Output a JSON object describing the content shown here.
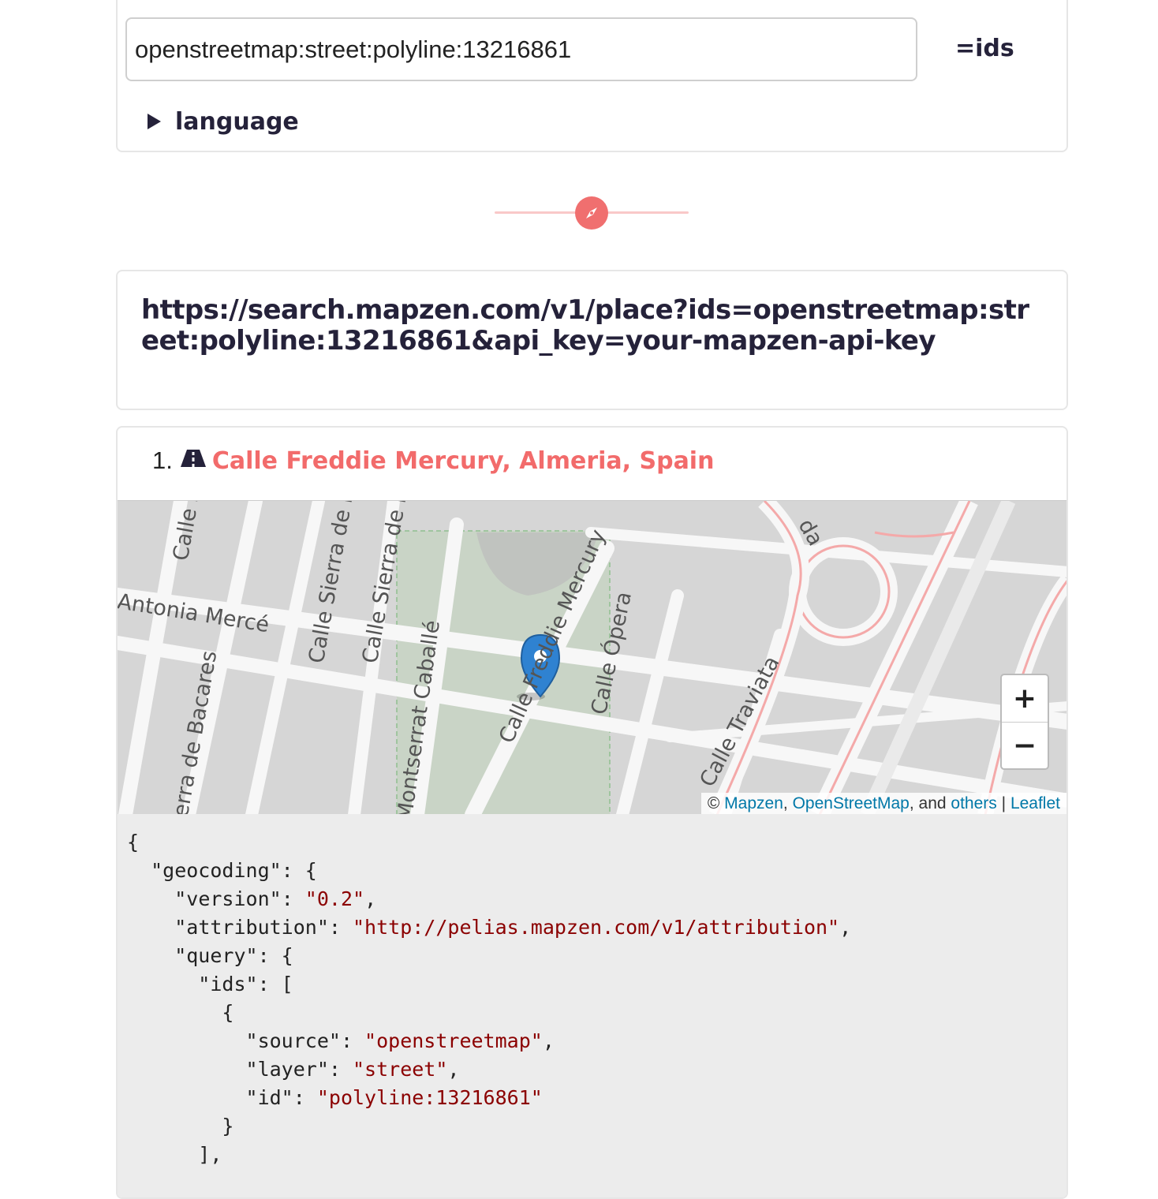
{
  "params": {
    "ids_value": "openstreetmap:street:polyline:13216861",
    "ids_label": "=ids",
    "language_label": "language"
  },
  "request": {
    "url": "https://search.mapzen.com/v1/place?ids=openstreetmap:street:polyline:13216861&api_key=your-mapzen-api-key"
  },
  "result": {
    "number": "1.",
    "name": "Calle Freddie Mercury, Almeria, Spain",
    "icon": "road-icon"
  },
  "map": {
    "streets": [
      "Calle S",
      "Antonia Mercé",
      "Calle Sierra de M",
      "Calle Sierra de M",
      "erra de Bacares",
      "Montserrat Caballé",
      "Calle Freddie Mercury",
      "Calle Ópera",
      "Calle Traviata",
      "da"
    ],
    "zoom_in": "+",
    "zoom_out": "−",
    "attribution": {
      "prefix": "©",
      "mapzen": "Mapzen",
      "sep1": ",",
      "osm": "OpenStreetMap",
      "sep2": ", and",
      "others": "others",
      "sep3": "|",
      "leaflet": "Leaflet"
    }
  },
  "json_lines": [
    "{",
    "  \"geocoding\": {",
    "    \"version\": \"0.2\",",
    "    \"attribution\": \"http://pelias.mapzen.com/v1/attribution\",",
    "    \"query\": {",
    "      \"ids\": [",
    "        {",
    "          \"source\": \"openstreetmap\",",
    "          \"layer\": \"street\",",
    "          \"id\": \"polyline:13216861\"",
    "        }",
    "      ],"
  ],
  "colors": {
    "accent": "#f26b6b",
    "text_dark": "#25223a",
    "json_string": "#8b0000",
    "link": "#0078a8"
  }
}
